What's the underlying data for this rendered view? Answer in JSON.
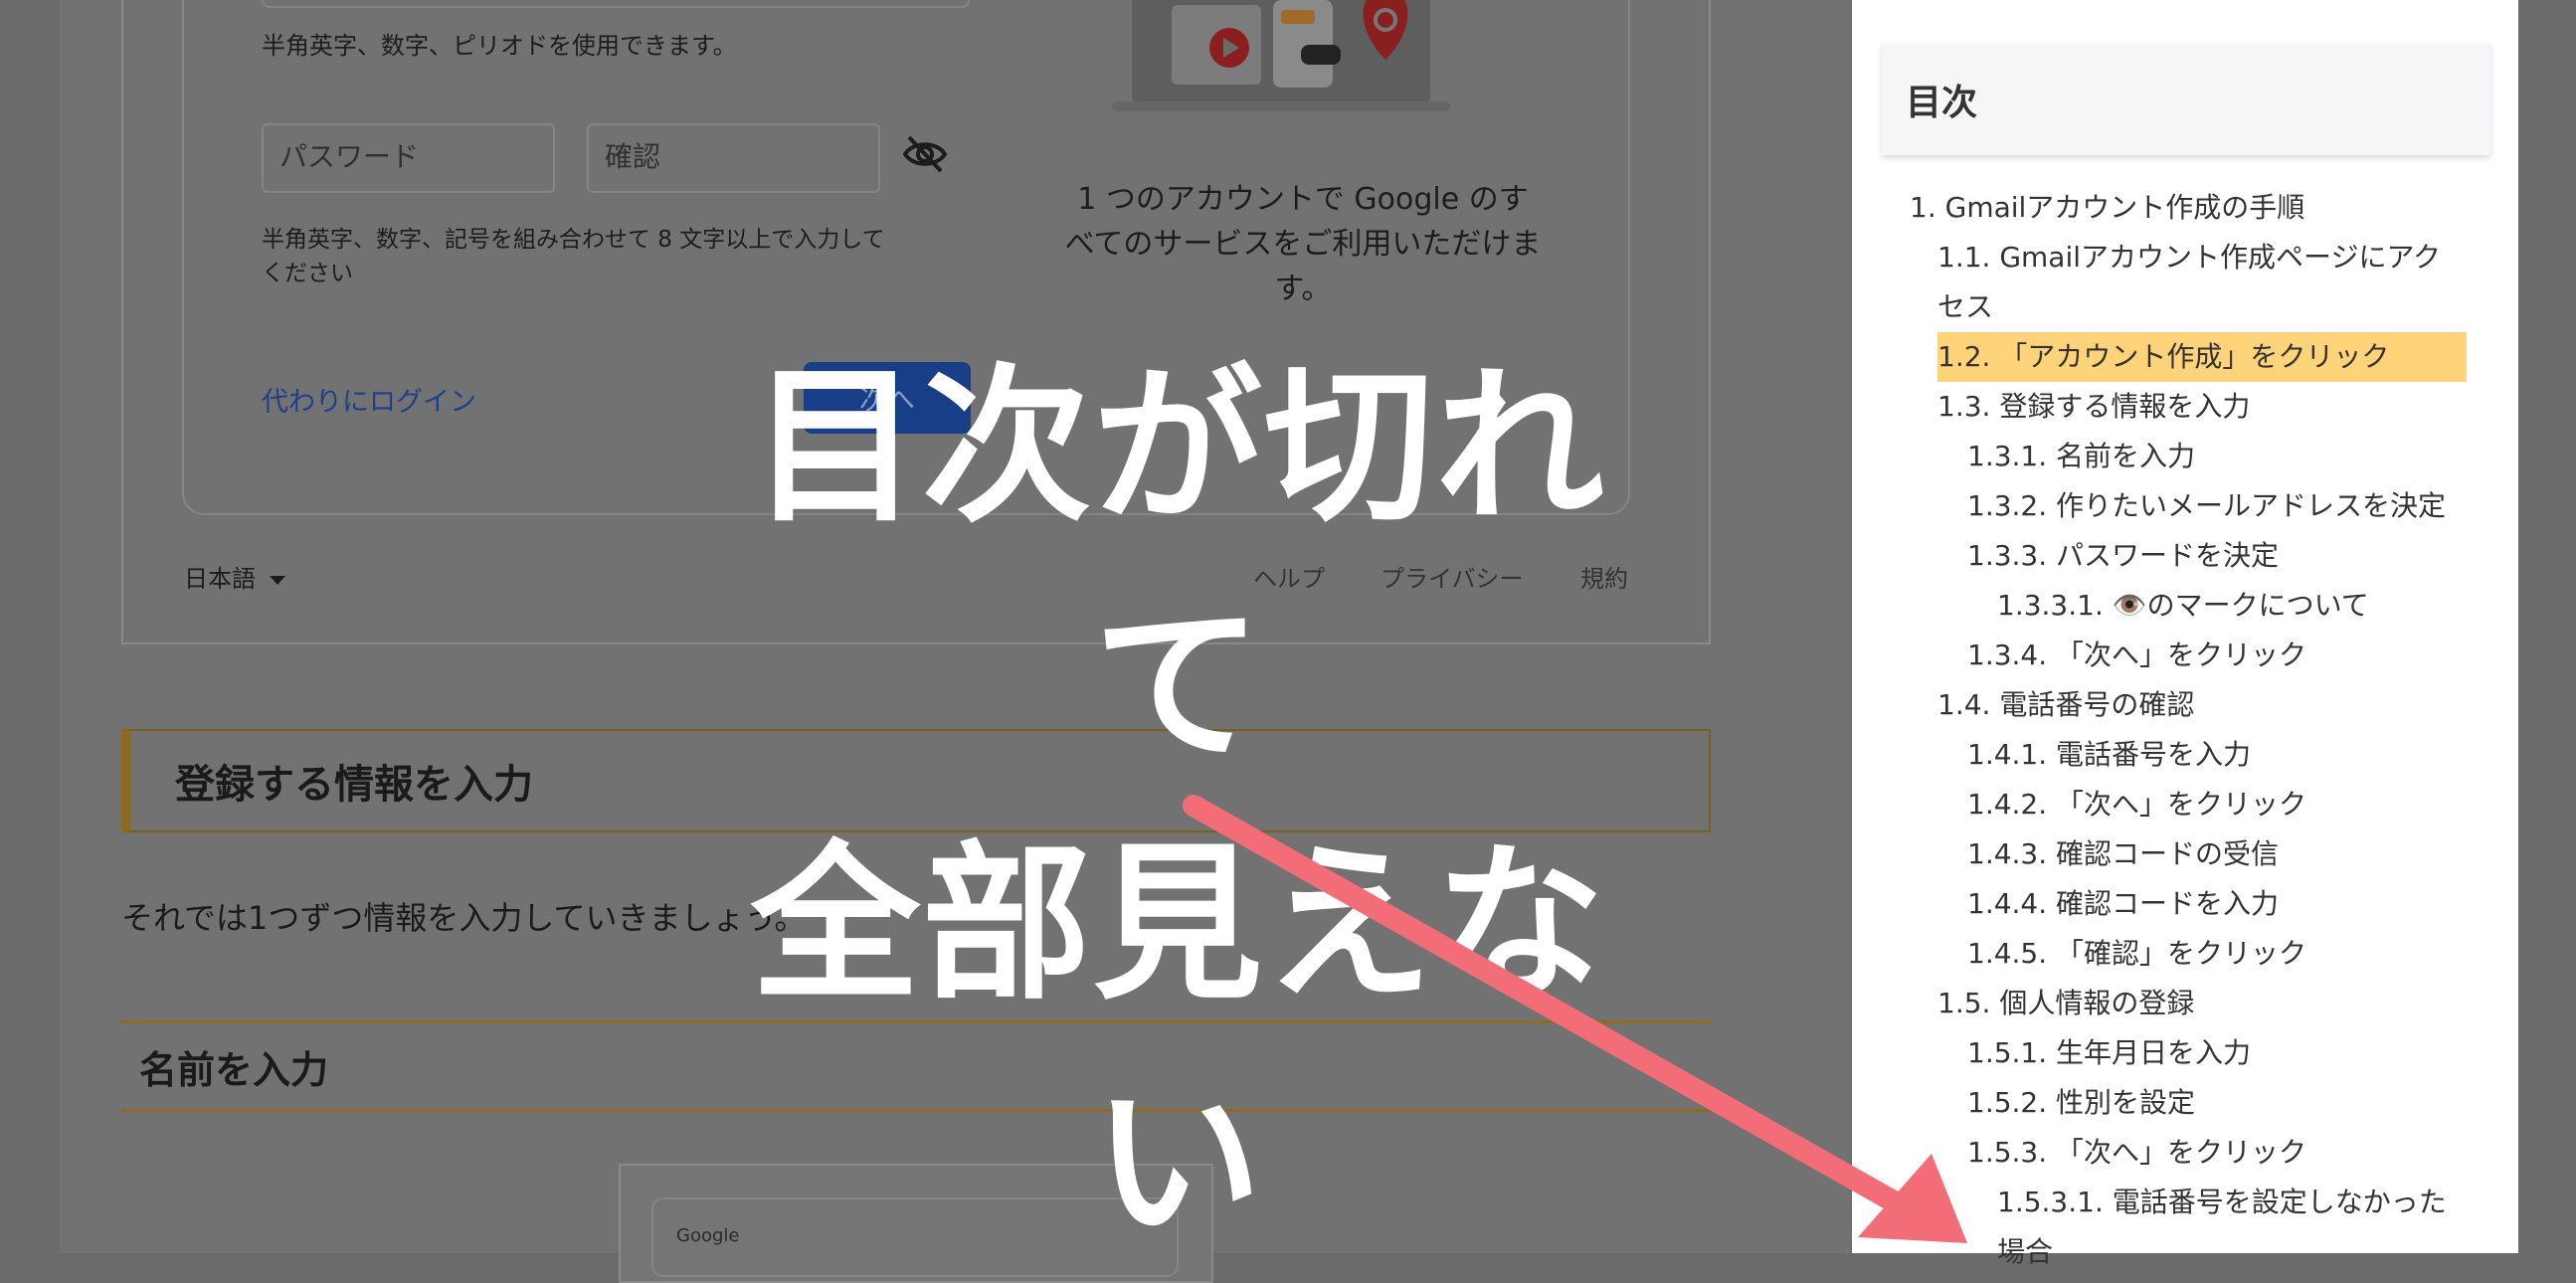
{
  "form": {
    "hint_username": "半角英字、数字、ピリオドを使用できます。",
    "password_placeholder": "パスワード",
    "confirm_placeholder": "確認",
    "hint_password": "半角英字、数字、記号を組み合わせて 8 文字以上で入力してください",
    "login_instead": "代わりにログイン",
    "next_button": "次へ",
    "promo_text": "1 つのアカウントで Google のすべてのサービスをご利用いただけます。",
    "language": "日本語",
    "footer_links": [
      "ヘルプ",
      "プライバシー",
      "規約"
    ]
  },
  "article": {
    "section_heading": "登録する情報を入力",
    "paragraph": "それでは1つずつ情報を入力していきましょう。",
    "subsection_heading": "名前を入力",
    "screenshot_logo": "Google"
  },
  "overlay": {
    "line1": "目次が切れて",
    "line2": "全部見えない",
    "arrow_color": "#f26d78"
  },
  "toc": {
    "title": "目次",
    "highlight_color": "#ffd37a",
    "items": [
      {
        "level": 1,
        "text": "1. Gmailアカウント作成の手順"
      },
      {
        "level": 2,
        "text": "1.1. Gmailアカウント作成ページにアクセス"
      },
      {
        "level": 2,
        "text": "1.2. 「アカウント作成」をクリック",
        "active": true
      },
      {
        "level": 2,
        "text": "1.3. 登録する情報を入力"
      },
      {
        "level": 3,
        "text": "1.3.1. 名前を入力"
      },
      {
        "level": 3,
        "text": "1.3.2. 作りたいメールアドレスを決定"
      },
      {
        "level": 3,
        "text": "1.3.3. パスワードを決定"
      },
      {
        "level": 4,
        "text": "1.3.3.1. 👁️のマークについて"
      },
      {
        "level": 3,
        "text": "1.3.4. 「次へ」をクリック"
      },
      {
        "level": 2,
        "text": "1.4. 電話番号の確認"
      },
      {
        "level": 3,
        "text": "1.4.1. 電話番号を入力"
      },
      {
        "level": 3,
        "text": "1.4.2. 「次へ」をクリック"
      },
      {
        "level": 3,
        "text": "1.4.3. 確認コードの受信"
      },
      {
        "level": 3,
        "text": "1.4.4. 確認コードを入力"
      },
      {
        "level": 3,
        "text": "1.4.5. 「確認」をクリック"
      },
      {
        "level": 2,
        "text": "1.5. 個人情報の登録"
      },
      {
        "level": 3,
        "text": "1.5.1. 生年月日を入力"
      },
      {
        "level": 3,
        "text": "1.5.2. 性別を設定"
      },
      {
        "level": 3,
        "text": "1.5.3. 「次へ」をクリック"
      },
      {
        "level": 4,
        "text": "1.5.3.1. 電話番号を設定しなかった場合"
      }
    ]
  }
}
